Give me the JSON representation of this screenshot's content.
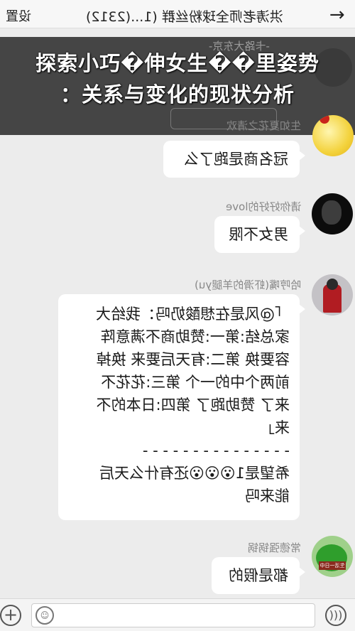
{
  "topbar": {
    "back_icon": "arrow-left-icon",
    "title": "洪涛老师全球粉丝群 (1...(2312)",
    "settings_label": "设置"
  },
  "banner": {
    "line1": "探索小巧�伸女生��里姿势",
    "line2": "：关系与变化的现状分析",
    "faded_name": "-卡路大东京-"
  },
  "messages": [
    {
      "name": "生如夏花之清欢",
      "lines": [
        "冠名商是跑了么"
      ]
    },
    {
      "name": "请你好好的love",
      "lines": [
        "男女不限"
      ]
    },
    {
      "name": "哈哼嘴(虾滑的羊腿yu)",
      "lines": [
        "「@风是在想酸奶吗：我给大",
        "家总结:第一:赞助商不满意阵",
        "容要换 第二:有天后要来 换掉",
        "前两个中的一个 第三:花花不",
        "来了 赞助跑了 第四:日本的不",
        "来」",
        "- - - - - - - - - - - - - - -",
        "希望是1😮😮😮还有什么天后",
        "能来吗"
      ]
    },
    {
      "name": "常德强锅锅",
      "lines": [
        "都是假的"
      ]
    }
  ],
  "avatar4_sign": "生活一日中",
  "bottombar": {
    "plus_icon": "plus-icon",
    "emoji_icon": "emoji-icon",
    "voice_icon": "voice-icon"
  }
}
